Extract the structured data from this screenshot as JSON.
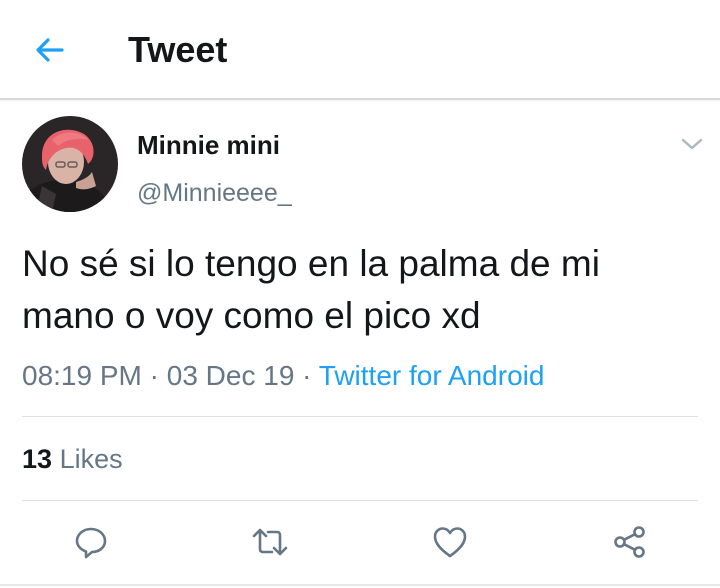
{
  "header": {
    "title": "Tweet",
    "back_icon": "arrow-left-icon"
  },
  "tweet": {
    "display_name": "Minnie mini",
    "handle": "@Minnieeee_",
    "text": "No sé si lo tengo en la palma de mi mano o voy como el pico xd",
    "time": "08:19 PM",
    "separator": " · ",
    "date": "03 Dec 19",
    "source": "Twitter for Android",
    "likes_count": "13",
    "likes_label": "Likes"
  },
  "actions": [
    "reply-icon",
    "retweet-icon",
    "like-icon",
    "share-icon"
  ],
  "colors": {
    "accent": "#1da1f2",
    "secondary_text": "#657786",
    "primary_text": "#14171a",
    "action_icon": "#657786"
  }
}
